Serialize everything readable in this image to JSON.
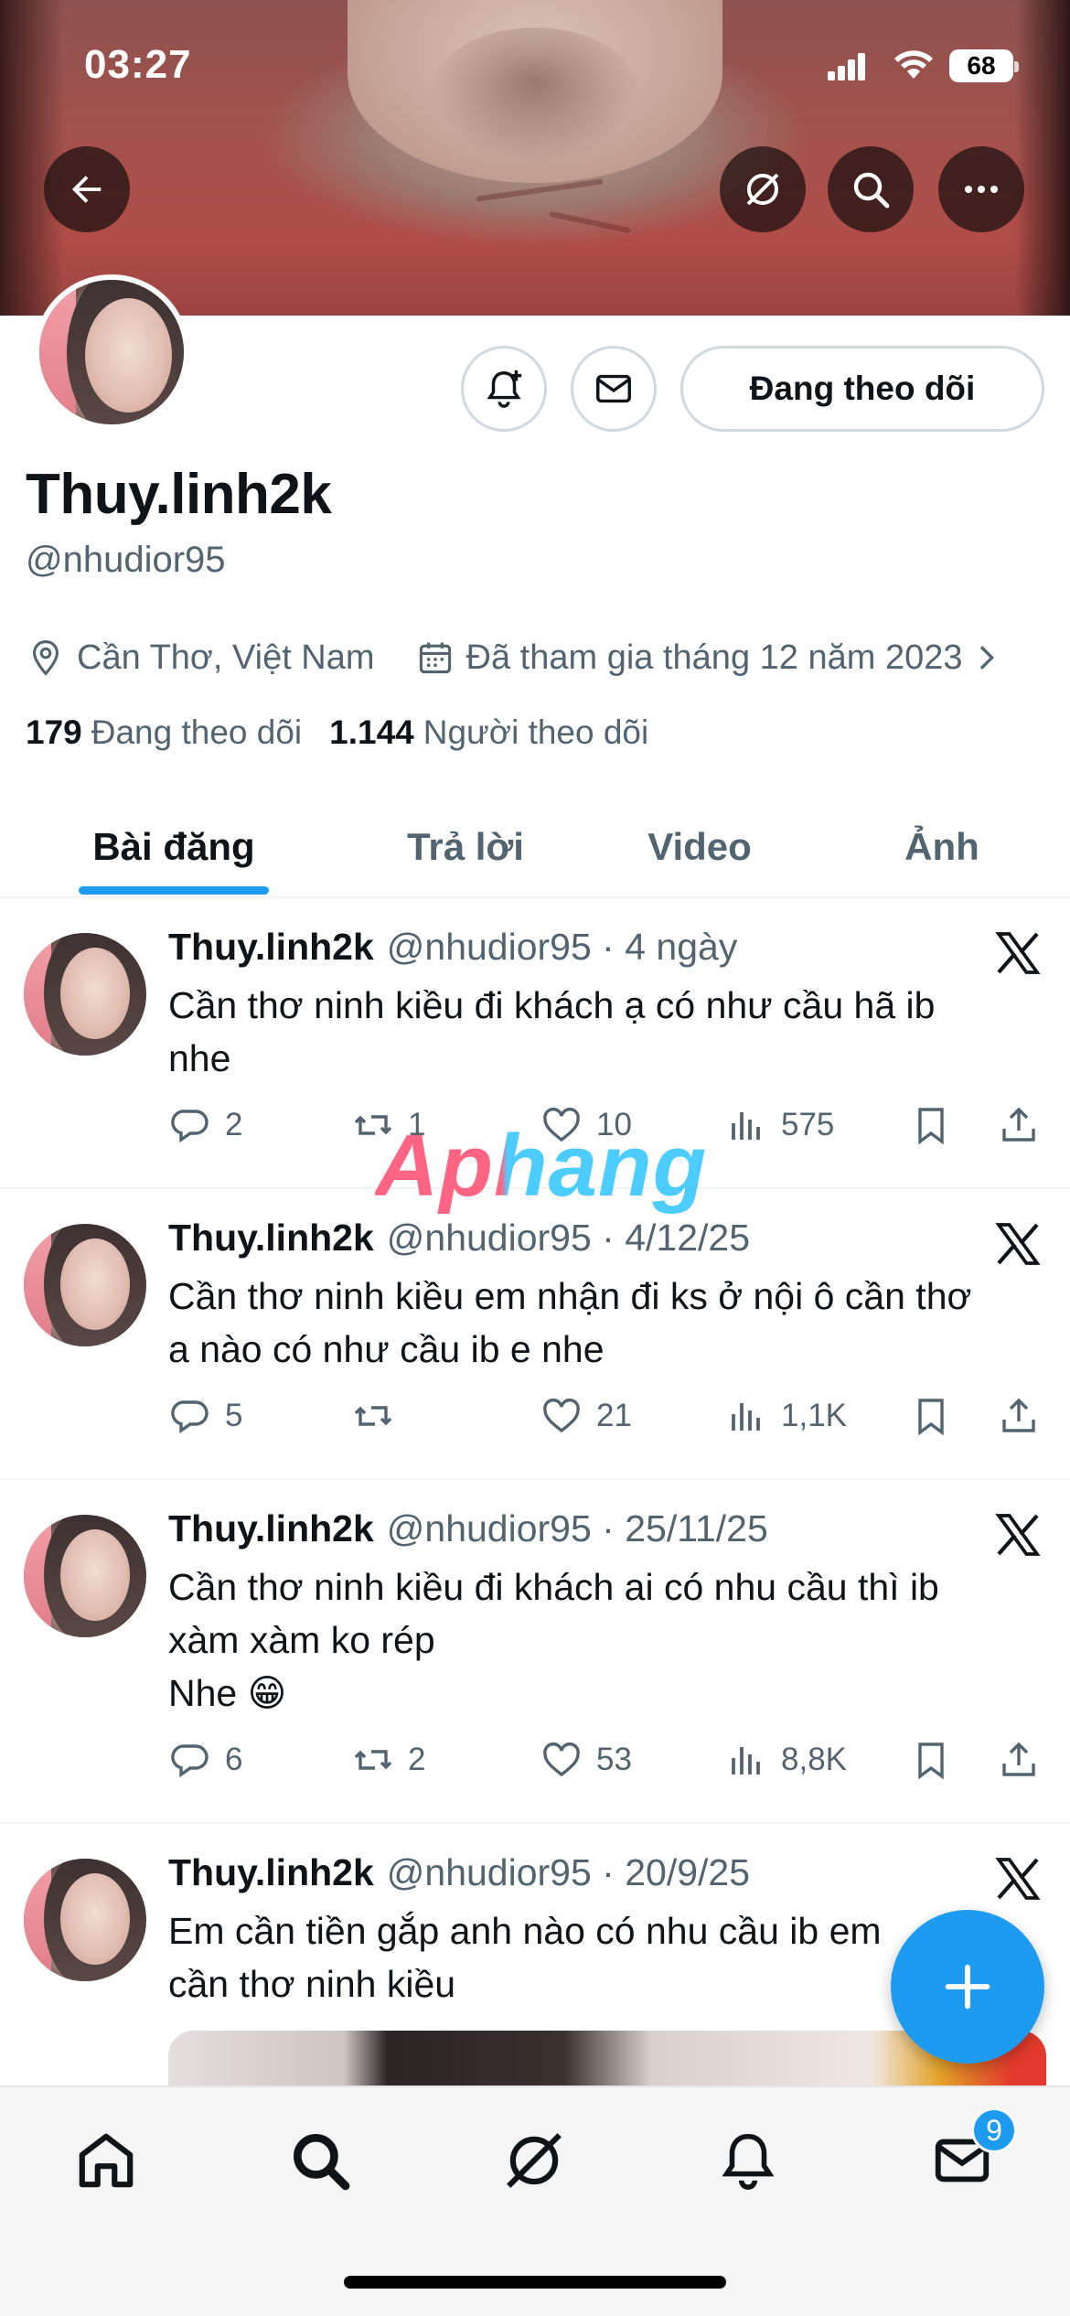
{
  "status_bar": {
    "time": "03:27",
    "battery": "68"
  },
  "profile": {
    "follow_button_label": "Đang theo dõi",
    "display_name": "Thuy.linh2k",
    "handle": "@nhudior95",
    "location": "Cần Thơ, Việt Nam",
    "joined": "Đã tham gia tháng 12 năm 2023",
    "following_count": "179",
    "following_label": "Đang theo dõi",
    "followers_count": "1.144",
    "followers_label": "Người theo dõi"
  },
  "tabs": [
    {
      "label": "Bài đăng",
      "active": true
    },
    {
      "label": "Trả lời",
      "active": false
    },
    {
      "label": "Video",
      "active": false
    },
    {
      "label": "Ảnh",
      "active": false
    }
  ],
  "posts": [
    {
      "name": "Thuy.linh2k",
      "handle": "@nhudior95",
      "dot": "·",
      "time": "4 ngày",
      "text": "Cần thơ ninh kiều đi khách ạ có như cầu hã ib\nnhe",
      "replies": "2",
      "reposts": "1",
      "likes": "10",
      "views": "575"
    },
    {
      "name": "Thuy.linh2k",
      "handle": "@nhudior95",
      "dot": "·",
      "time": "4/12/25",
      "text": "Cần thơ ninh kiều em nhận đi ks ở nội ô cần thơ\na nào có như cầu ib e nhe",
      "replies": "5",
      "reposts": "",
      "likes": "21",
      "views": "1,1K"
    },
    {
      "name": "Thuy.linh2k",
      "handle": "@nhudior95",
      "dot": "·",
      "time": "25/11/25",
      "text": "Cần thơ ninh kiều đi khách ai có nhu cầu thì ib\nxàm xàm ko rép\nNhe 😁",
      "replies": "6",
      "reposts": "2",
      "likes": "53",
      "views": "8,8K"
    },
    {
      "name": "Thuy.linh2k",
      "handle": "@nhudior95",
      "dot": "·",
      "time": "20/9/25",
      "text": "Em cần tiền gắp anh nào có nhu cầu ib em\ncần thơ ninh kiều",
      "replies": "",
      "reposts": "",
      "likes": "",
      "views": ""
    }
  ],
  "watermark": "Aphang",
  "bottom_nav": {
    "messages_badge": "9"
  },
  "colors": {
    "accent": "#1d9bf0",
    "text_primary": "#0f1419",
    "text_secondary": "#536471"
  },
  "icons": [
    "back-arrow-icon",
    "grok-icon",
    "search-icon",
    "more-icon",
    "bell-plus-icon",
    "mail-icon",
    "location-pin-icon",
    "calendar-icon",
    "chevron-right-icon",
    "x-logo-icon",
    "reply-icon",
    "repost-icon",
    "like-icon",
    "views-icon",
    "bookmark-icon",
    "share-icon",
    "compose-plus-icon",
    "home-icon",
    "notifications-icon",
    "messages-icon"
  ]
}
